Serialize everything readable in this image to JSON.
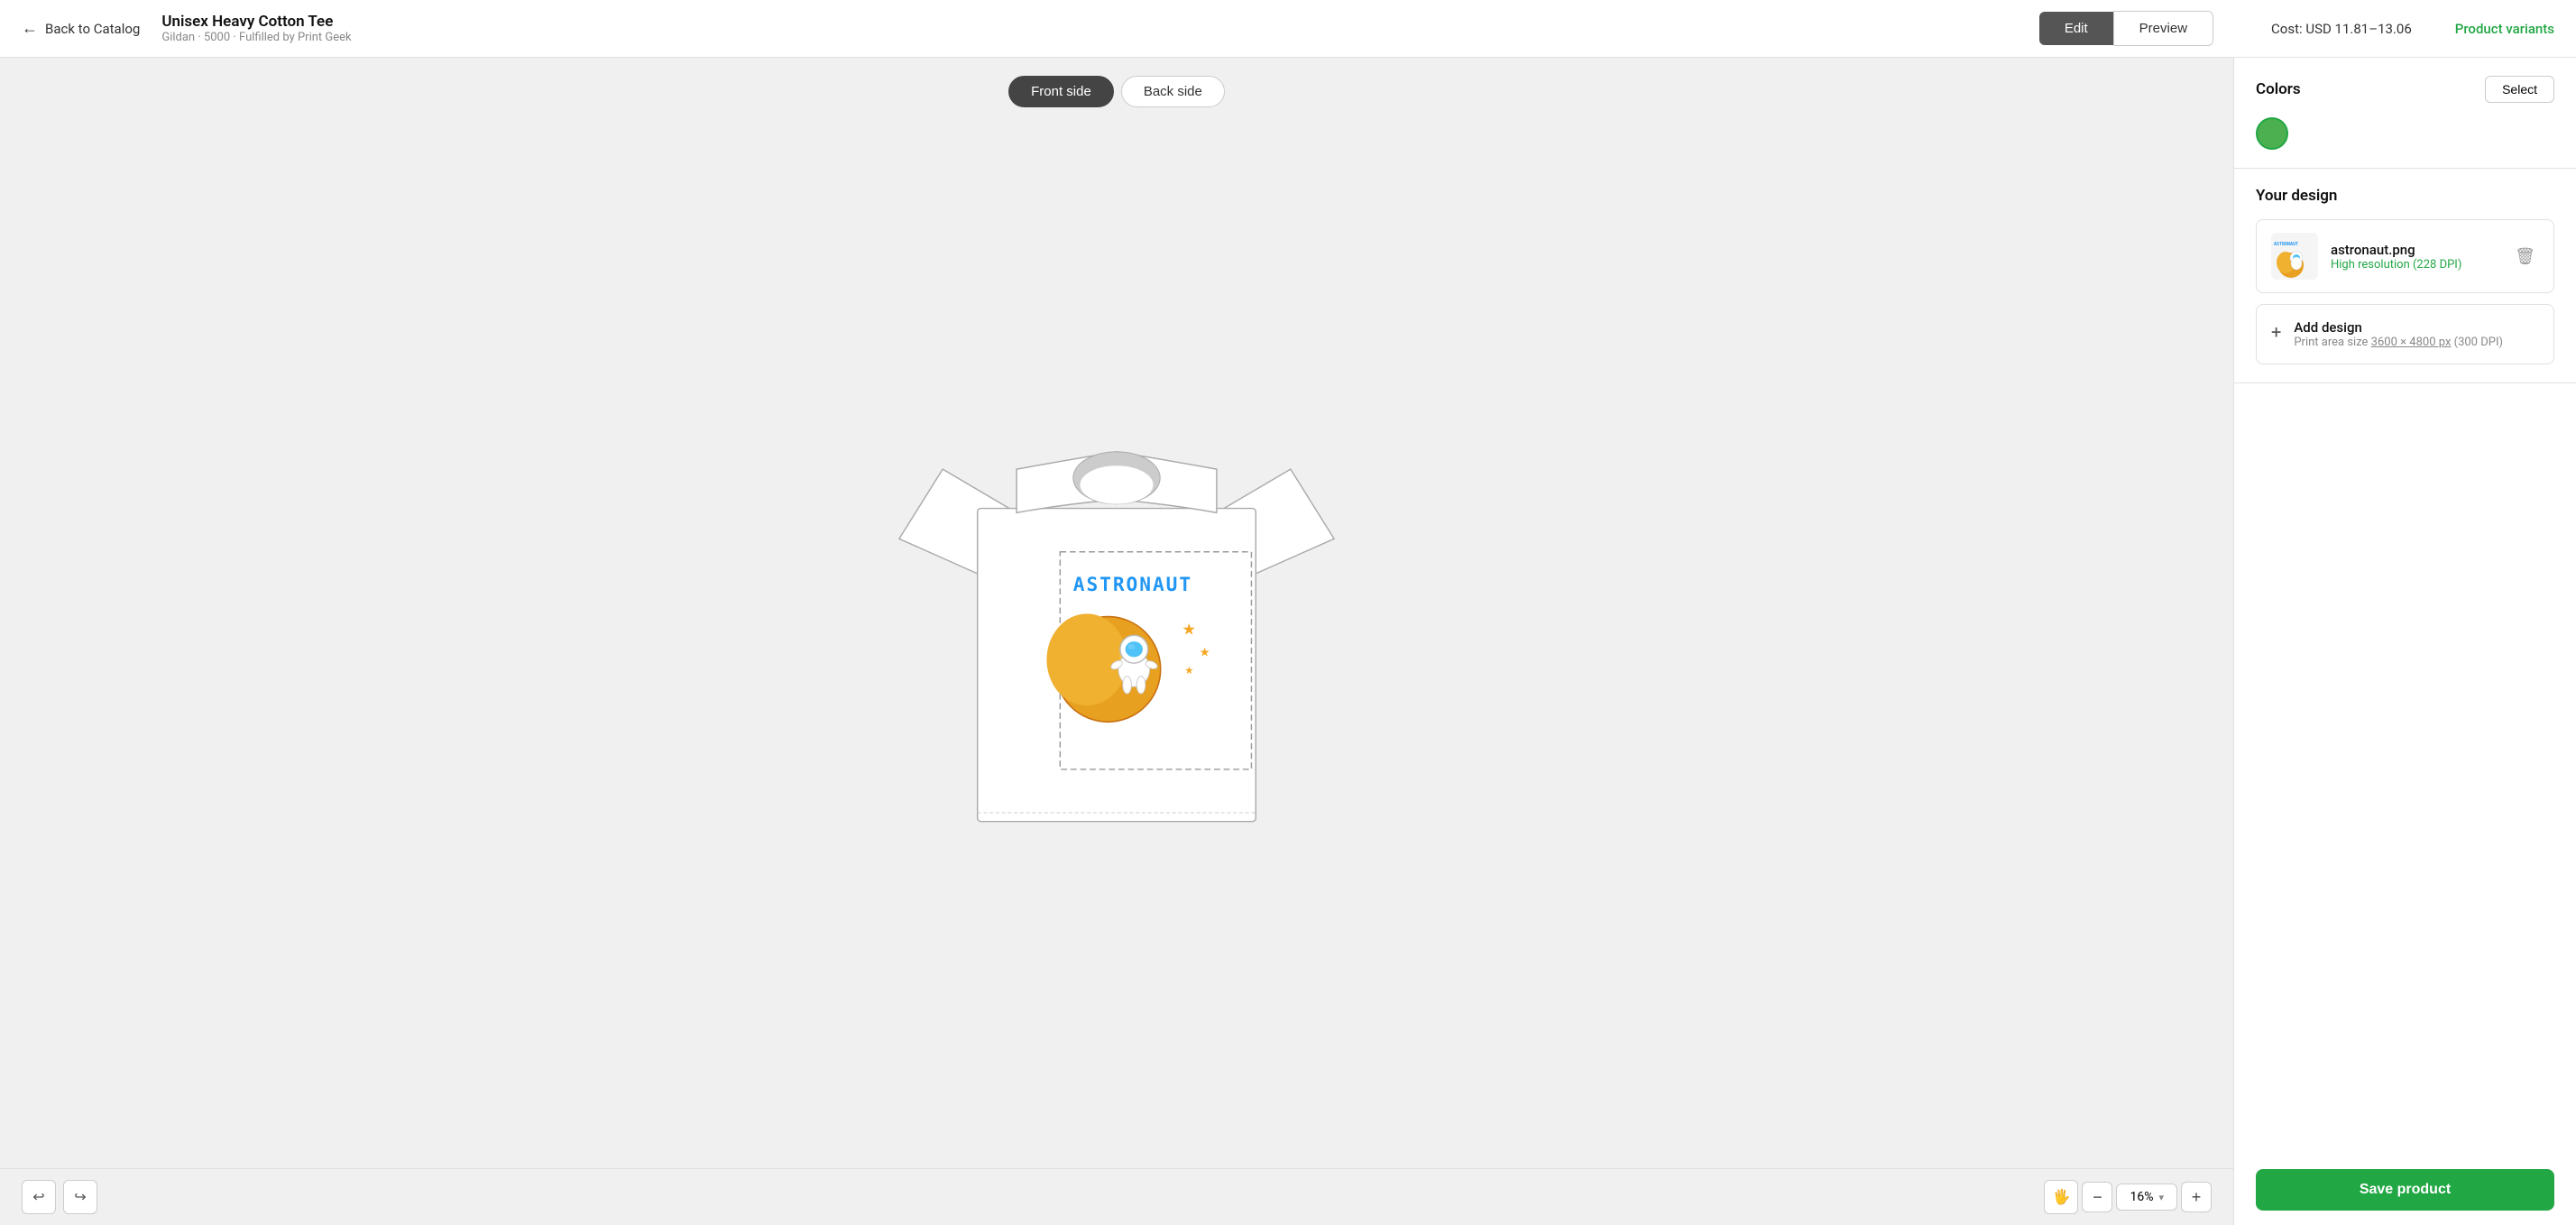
{
  "header": {
    "back_label": "Back to Catalog",
    "product_title": "Unisex Heavy Cotton Tee",
    "product_subtitle": "Gildan · 5000 · Fulfilled by Print Geek",
    "edit_label": "Edit",
    "preview_label": "Preview",
    "cost_label": "Cost: USD 11.81–13.06",
    "variants_label": "Product variants"
  },
  "tabs": {
    "front_label": "Front side",
    "back_label": "Back side"
  },
  "colors": {
    "title": "Colors",
    "select_label": "Select",
    "swatches": [
      {
        "color": "#4caf50",
        "selected": true,
        "name": "green"
      }
    ]
  },
  "your_design": {
    "title": "Your design",
    "design_file": {
      "name": "astronaut.png",
      "resolution": "High resolution (228 DPI)"
    },
    "add_design": {
      "label": "Add design",
      "sub": "Print area size ",
      "area": "3600 × 4800 px",
      "dpi": " (300 DPI)"
    }
  },
  "bottom": {
    "zoom_value": "16%",
    "save_label": "Save product"
  },
  "icons": {
    "undo": "↩",
    "redo": "↪",
    "hand": "✋",
    "minus": "−",
    "plus": "+",
    "trash": "🗑",
    "add_plus": "+"
  }
}
